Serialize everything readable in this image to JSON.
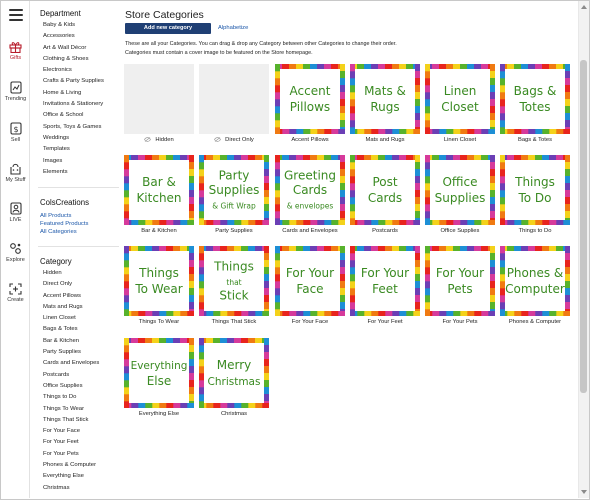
{
  "rail": {
    "items": [
      {
        "label": "Gifts",
        "icon": "gift-icon",
        "active": true
      },
      {
        "label": "Trending",
        "icon": "trending-icon",
        "active": false
      },
      {
        "label": "Sell",
        "icon": "sell-icon",
        "active": false
      },
      {
        "label": "My Stuff",
        "icon": "my-stuff-icon",
        "active": false
      },
      {
        "label": "LIVE",
        "icon": "live-icon",
        "active": false
      },
      {
        "label": "Explore",
        "icon": "explore-icon",
        "active": false
      },
      {
        "label": "Create",
        "icon": "create-icon",
        "active": false
      }
    ]
  },
  "sidebar": {
    "department_heading": "Department",
    "departments": [
      "Baby & Kids",
      "Accessories",
      "Art & Wall Décor",
      "Clothing & Shoes",
      "Electronics",
      "Crafts & Party Supplies",
      "Home & Living",
      "Invitations & Stationery",
      "Office & School",
      "Sports, Toys & Games",
      "Weddings",
      "Templates",
      "Images",
      "Elements"
    ],
    "store_heading": "ColsCreations",
    "store_links": [
      "All Products",
      "Featured Products",
      "All Categories"
    ],
    "category_heading": "Category",
    "categories": [
      "Hidden",
      "Direct Only",
      "Accent Pillows",
      "Mats and Rugs",
      "Linen Closet",
      "Bags & Totes",
      "Bar & Kitchen",
      "Party Supplies",
      "Cards and Envelopes",
      "Postcards",
      "Office Supplies",
      "Things to Do",
      "Things To Wear",
      "Things That Stick",
      "For Your Face",
      "For Your Feet",
      "For Your Pets",
      "Phones & Computer",
      "Everything Else",
      "Christmas"
    ]
  },
  "main": {
    "title": "Store Categories",
    "add_button": "Add new category",
    "alphabetize": "Alphabetize",
    "desc_line1": "These are all your Categories. You can drag & drop any Category between other Categories to change their order.",
    "desc_line2": "Categories must contain a cover image to be featured on the Store homepage.",
    "tiles": [
      {
        "label": "Hidden",
        "lines": [],
        "empty": true
      },
      {
        "label": "Direct Only",
        "lines": [],
        "empty": true
      },
      {
        "label": "Accent Pillows",
        "lines": [
          "Accent",
          "Pillows"
        ]
      },
      {
        "label": "Mats and Rugs",
        "lines": [
          "Mats &",
          "Rugs"
        ]
      },
      {
        "label": "Linen Closet",
        "lines": [
          "Linen",
          "Closet"
        ]
      },
      {
        "label": "Bags & Totes",
        "lines": [
          "Bags &",
          "Totes"
        ]
      },
      {
        "label": "Bar & Kitchen",
        "lines": [
          "Bar &",
          "Kitchen"
        ]
      },
      {
        "label": "Party Supplies",
        "lines": [
          "Party",
          "Supplies",
          "& Gift Wrap"
        ]
      },
      {
        "label": "Cards and Envelopes",
        "lines": [
          "Greeting",
          "Cards",
          "& envelopes"
        ]
      },
      {
        "label": "Postcards",
        "lines": [
          "Post",
          "Cards"
        ]
      },
      {
        "label": "Office Supplies",
        "lines": [
          "Office",
          "Supplies"
        ]
      },
      {
        "label": "Things to Do",
        "lines": [
          "Things",
          "To Do"
        ]
      },
      {
        "label": "Things To Wear",
        "lines": [
          "Things",
          "To Wear"
        ]
      },
      {
        "label": "Things That Stick",
        "lines": [
          "Things",
          "that",
          "Stick"
        ]
      },
      {
        "label": "For Your Face",
        "lines": [
          "For Your",
          "Face"
        ]
      },
      {
        "label": "For Your Feet",
        "lines": [
          "For Your",
          "Feet"
        ]
      },
      {
        "label": "For Your Pets",
        "lines": [
          "For Your",
          "Pets"
        ]
      },
      {
        "label": "Phones & Computer",
        "lines": [
          "Phones &",
          "Computer"
        ]
      },
      {
        "label": "Everything Else",
        "lines": [
          "Everything",
          "Else"
        ]
      },
      {
        "label": "Christmas",
        "lines": [
          "Merry",
          "Christmas"
        ]
      }
    ]
  },
  "colors": {
    "accent_red": "#b71c2b",
    "button_navy": "#1f3f74",
    "link_blue": "#1a56a8",
    "tile_text": "#3a8a22"
  }
}
